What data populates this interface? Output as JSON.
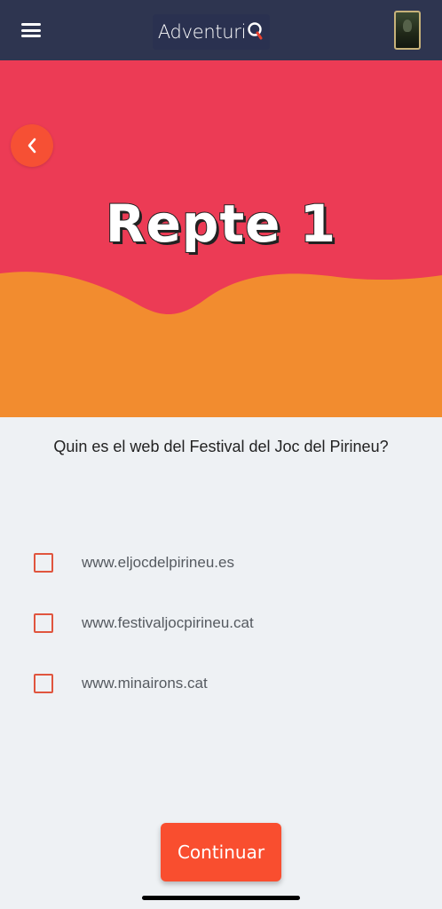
{
  "header": {
    "menu_icon": "hamburger-menu-icon",
    "brand_name": "Adventuri",
    "brand_mark_icon": "map-pin-q-icon",
    "avatar_icon": "profile-portrait"
  },
  "hero": {
    "title": "Repte 1",
    "back_icon": "chevron-left-icon",
    "colors": {
      "top": "#ec3b55",
      "bottom": "#f28c2f"
    }
  },
  "quiz": {
    "question": "Quin es el web del Festival del Joc del Pirineu?",
    "options": [
      {
        "label": "www.eljocdelpirineu.es",
        "checked": false
      },
      {
        "label": "www.festivaljocpirineu.cat",
        "checked": false
      },
      {
        "label": "www.minairons.cat",
        "checked": false
      }
    ]
  },
  "actions": {
    "continue_label": "Continuar",
    "accent_color": "#f94e2f"
  }
}
